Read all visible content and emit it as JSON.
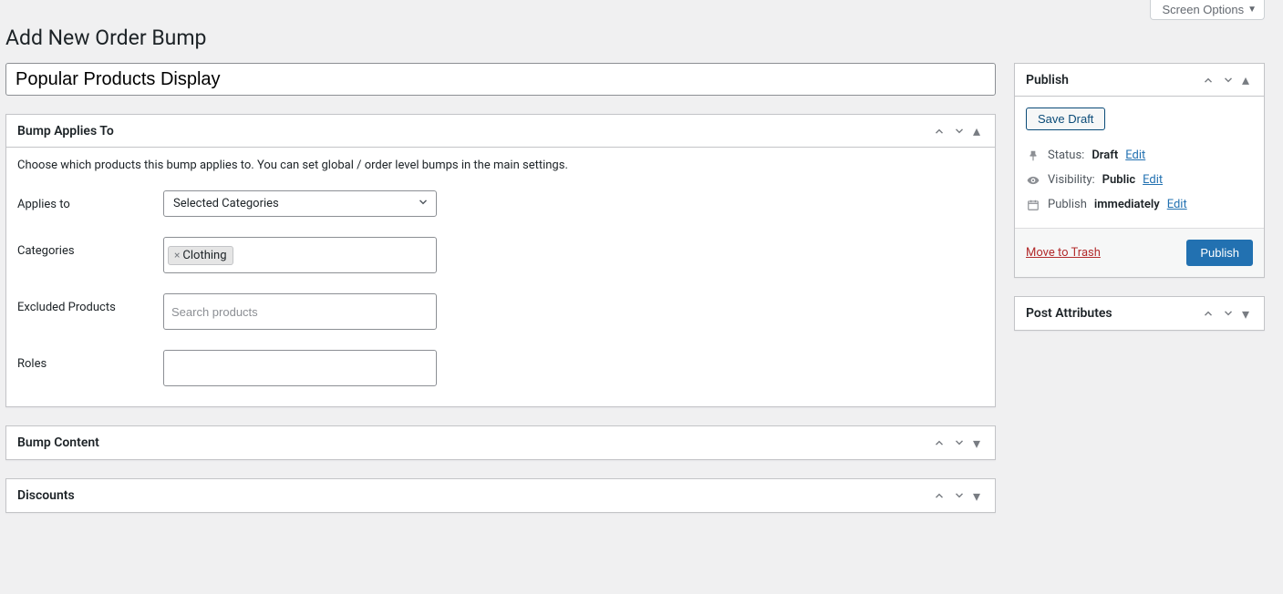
{
  "screen_options": "Screen Options",
  "page_title": "Add New Order Bump",
  "title_value": "Popular Products Display",
  "metaboxes": {
    "applies": {
      "title": "Bump Applies To",
      "help": "Choose which products this bump applies to. You can set global / order level bumps in the main settings.",
      "rows": {
        "applies_to": {
          "label": "Applies to",
          "value": "Selected Categories"
        },
        "categories": {
          "label": "Categories",
          "tags": [
            "Clothing"
          ]
        },
        "excluded": {
          "label": "Excluded Products",
          "placeholder": "Search products"
        },
        "roles": {
          "label": "Roles"
        }
      }
    },
    "content": {
      "title": "Bump Content"
    },
    "discounts": {
      "title": "Discounts"
    }
  },
  "publish": {
    "title": "Publish",
    "save_draft": "Save Draft",
    "status_label": "Status:",
    "status_value": "Draft",
    "visibility_label": "Visibility:",
    "visibility_value": "Public",
    "publish_label": "Publish",
    "publish_value": "immediately",
    "edit": "Edit",
    "move_trash": "Move to Trash",
    "publish_btn": "Publish"
  },
  "post_attributes": {
    "title": "Post Attributes"
  }
}
